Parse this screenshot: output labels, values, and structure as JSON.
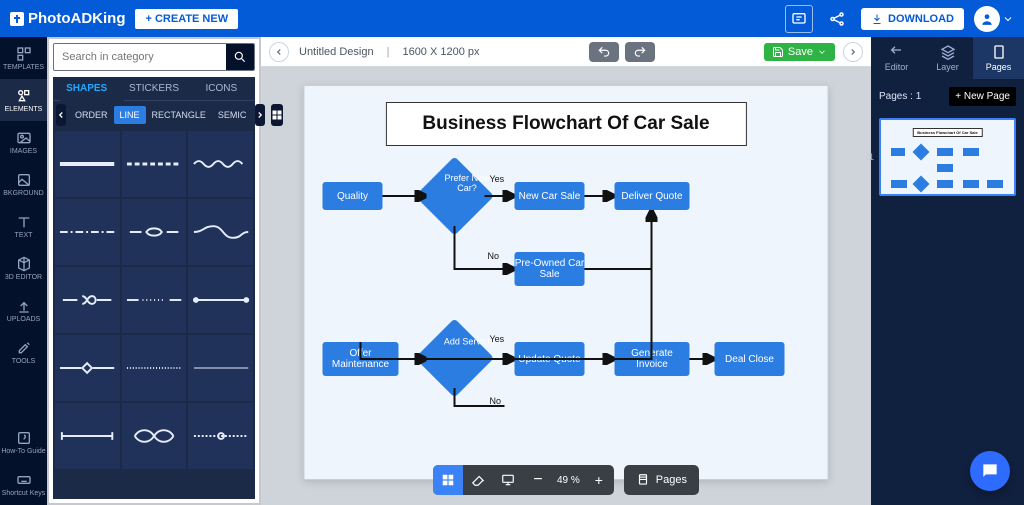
{
  "app": {
    "brand": "PhotoADKing"
  },
  "header": {
    "create_new": "+ CREATE NEW",
    "download": "DOWNLOAD"
  },
  "rail": [
    {
      "id": "templates",
      "label": "TEMPLATES"
    },
    {
      "id": "elements",
      "label": "ELEMENTS"
    },
    {
      "id": "images",
      "label": "IMAGES"
    },
    {
      "id": "bkground",
      "label": "BKGROUND"
    },
    {
      "id": "text",
      "label": "TEXT"
    },
    {
      "id": "3deditor",
      "label": "3D EDITOR"
    },
    {
      "id": "uploads",
      "label": "UPLOADS"
    },
    {
      "id": "tools",
      "label": "TOOLS"
    }
  ],
  "rail_bottom": [
    {
      "id": "howto",
      "label": "How-To Guide"
    },
    {
      "id": "shortcuts",
      "label": "Shortcut Keys"
    }
  ],
  "panel": {
    "search_placeholder": "Search in category",
    "tabs": [
      "SHAPES",
      "STICKERS",
      "ICONS"
    ],
    "categories": [
      "ORDER",
      "LINE",
      "RECTANGLE",
      "SEMIC"
    ]
  },
  "canvas": {
    "doc_name": "Untitled Design",
    "dims": "1600 X 1200 px",
    "save": "Save",
    "title": "Business Flowchart Of Car Sale",
    "nodes": {
      "quality": "Quality",
      "prefer": "Prefer New Car?",
      "newcar": "New Car Sale",
      "deliver": "Deliver Quote",
      "preowned": "Pre-Owned Car Sale",
      "offer": "Offer Maintenance",
      "addservice": "Add Service?",
      "update": "Update Quote",
      "generate": "Generate Invoice",
      "close": "Deal Close",
      "yes": "Yes",
      "no": "No"
    }
  },
  "bottombar": {
    "zoom": "49 %",
    "pages": "Pages"
  },
  "right": {
    "tabs": [
      "Editor",
      "Layer",
      "Pages"
    ],
    "pages_label": "Pages : 1",
    "new_page": "+ New Page"
  }
}
